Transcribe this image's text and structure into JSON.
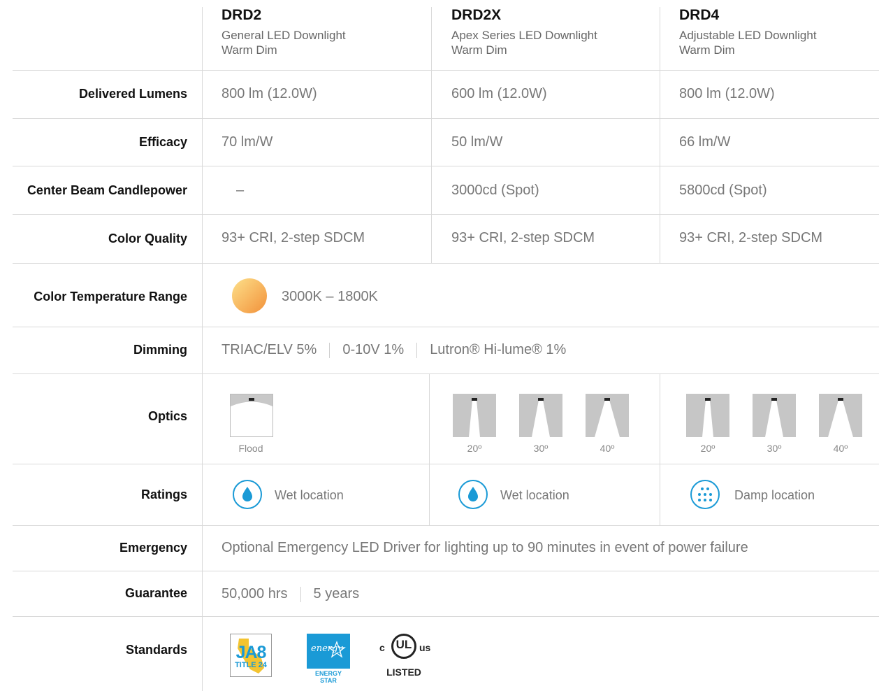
{
  "products": [
    {
      "name": "DRD2",
      "series": "General LED Downlight",
      "dim": "Warm Dim"
    },
    {
      "name": "DRD2X",
      "series": "Apex Series LED Downlight",
      "dim": "Warm Dim"
    },
    {
      "name": "DRD4",
      "series": "Adjustable LED Downlight",
      "dim": "Warm Dim"
    }
  ],
  "rows": {
    "lumens": {
      "label": "Delivered Lumens",
      "values": [
        "800 lm (12.0W)",
        "600 lm (12.0W)",
        "800 lm (12.0W)"
      ]
    },
    "efficacy": {
      "label": "Efficacy",
      "values": [
        "70 lm/W",
        "50 lm/W",
        "66 lm/W"
      ]
    },
    "cbcp": {
      "label": "Center Beam Candlepower",
      "values": [
        "–",
        "3000cd (Spot)",
        "5800cd (Spot)"
      ]
    },
    "color_quality": {
      "label": "Color Quality",
      "values": [
        "93+ CRI, 2-step SDCM",
        "93+ CRI, 2-step SDCM",
        "93+ CRI, 2-step SDCM"
      ]
    },
    "color_temp": {
      "label": "Color Temperature Range",
      "value": "3000K – 1800K"
    },
    "dimming": {
      "label": "Dimming",
      "options": [
        "TRIAC/ELV 5%",
        "0-10V 1%",
        "Lutron® Hi-lume® 1%"
      ]
    },
    "optics": {
      "label": "Optics",
      "drd2": [
        "Flood"
      ],
      "drd2x": [
        "20º",
        "30º",
        "40º"
      ],
      "drd4": [
        "20º",
        "30º",
        "40º"
      ]
    },
    "ratings": {
      "label": "Ratings",
      "values": [
        "Wet location",
        "Wet location",
        "Damp location"
      ]
    },
    "emergency": {
      "label": "Emergency",
      "value": "Optional Emergency LED Driver for lighting up to 90 minutes in event of power failure"
    },
    "guarantee": {
      "label": "Guarantee",
      "hours": "50,000 hrs",
      "years": "5 years"
    },
    "standards": {
      "label": "Standards",
      "ja8_top": "JA8",
      "ja8_bottom": "TITLE 24",
      "energy_star": "ENERGY STAR",
      "energy_script": "energy",
      "ul_c": "c",
      "ul_mark": "UL",
      "ul_us": "us",
      "ul_listed": "LISTED"
    }
  },
  "colors": {
    "accent_blue": "#1a9ad6",
    "gradient_start": "#fde08a",
    "gradient_end": "#f2913a"
  }
}
